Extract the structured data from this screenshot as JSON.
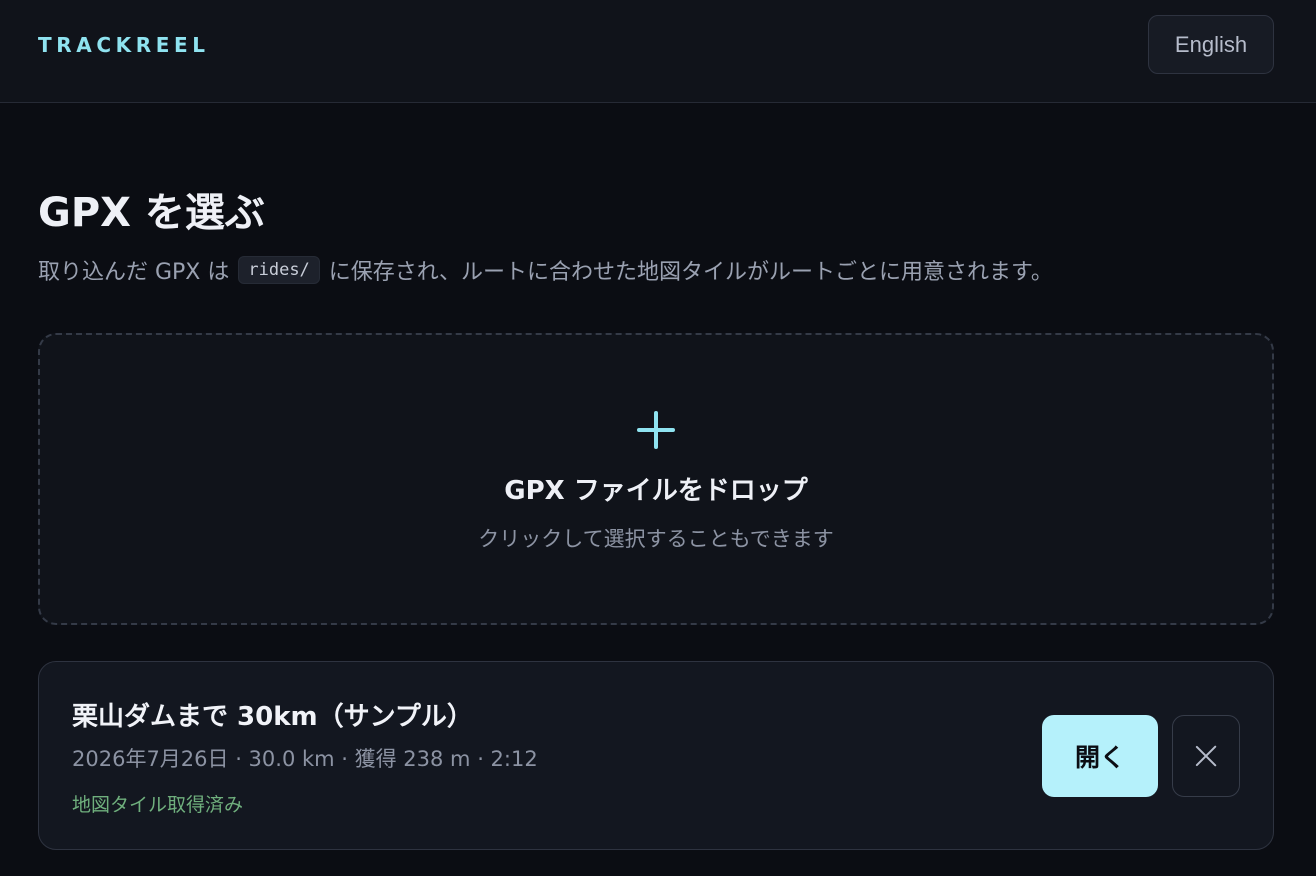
{
  "app": {
    "brand": "TRACKREEL",
    "language_button": "English"
  },
  "page": {
    "title": "GPX を選ぶ",
    "subtitle_before": "取り込んだ GPX は",
    "subtitle_code": "rides/",
    "subtitle_after": "に保存され、ルートに合わせた地図タイルがルートごとに用意されます。"
  },
  "dropzone": {
    "icon": "plus-icon",
    "title": "GPX ファイルをドロップ",
    "hint": "クリックして選択することもできます"
  },
  "rides": [
    {
      "title": "栗山ダムまで 30km（サンプル）",
      "meta": "2026年7月26日 · 30.0 km · 獲得 238 m · 2:12",
      "status": "地図タイル取得済み",
      "open_label": "開く",
      "delete_icon": "close-icon"
    }
  ],
  "colors": {
    "accent": "#8fe3f0",
    "open_button": "#b5f1fb",
    "status_ok": "#6faf7d",
    "background": "#0b0d13"
  }
}
